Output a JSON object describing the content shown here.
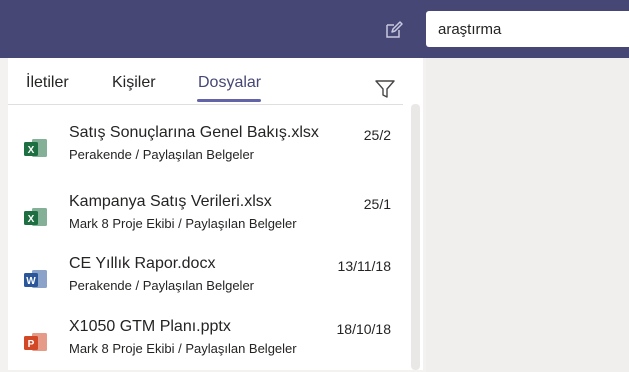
{
  "search": {
    "value": "araştırma"
  },
  "tabs": [
    {
      "label": "İletiler"
    },
    {
      "label": "Kişiler"
    },
    {
      "label": "Dosyalar"
    }
  ],
  "files": [
    {
      "name": "Satış Sonuçlarına Genel Bakış.xlsx",
      "location": "Perakende / Paylaşılan Belgeler",
      "date": "25/2",
      "icon": "excel-icon",
      "color": "#1d6f42",
      "glyph": "X"
    },
    {
      "name": "Kampanya Satış Verileri.xlsx",
      "location": "Mark 8 Proje Ekibi / Paylaşılan Belgeler",
      "date": "25/1",
      "icon": "excel-icon",
      "color": "#1d6f42",
      "glyph": "X"
    },
    {
      "name": "CE Yıllık Rapor.docx",
      "location": "Perakende / Paylaşılan Belgeler",
      "date": "13/11/18",
      "icon": "word-icon",
      "color": "#2b579a",
      "glyph": "W"
    },
    {
      "name": "X1050 GTM Planı.pptx",
      "location": "Mark 8 Proje Ekibi / Paylaşılan Belgeler",
      "date": "18/10/18",
      "icon": "powerpoint-icon",
      "color": "#d24726",
      "glyph": "P"
    }
  ],
  "colors": {
    "header": "#464775",
    "accent": "#6264a7"
  }
}
